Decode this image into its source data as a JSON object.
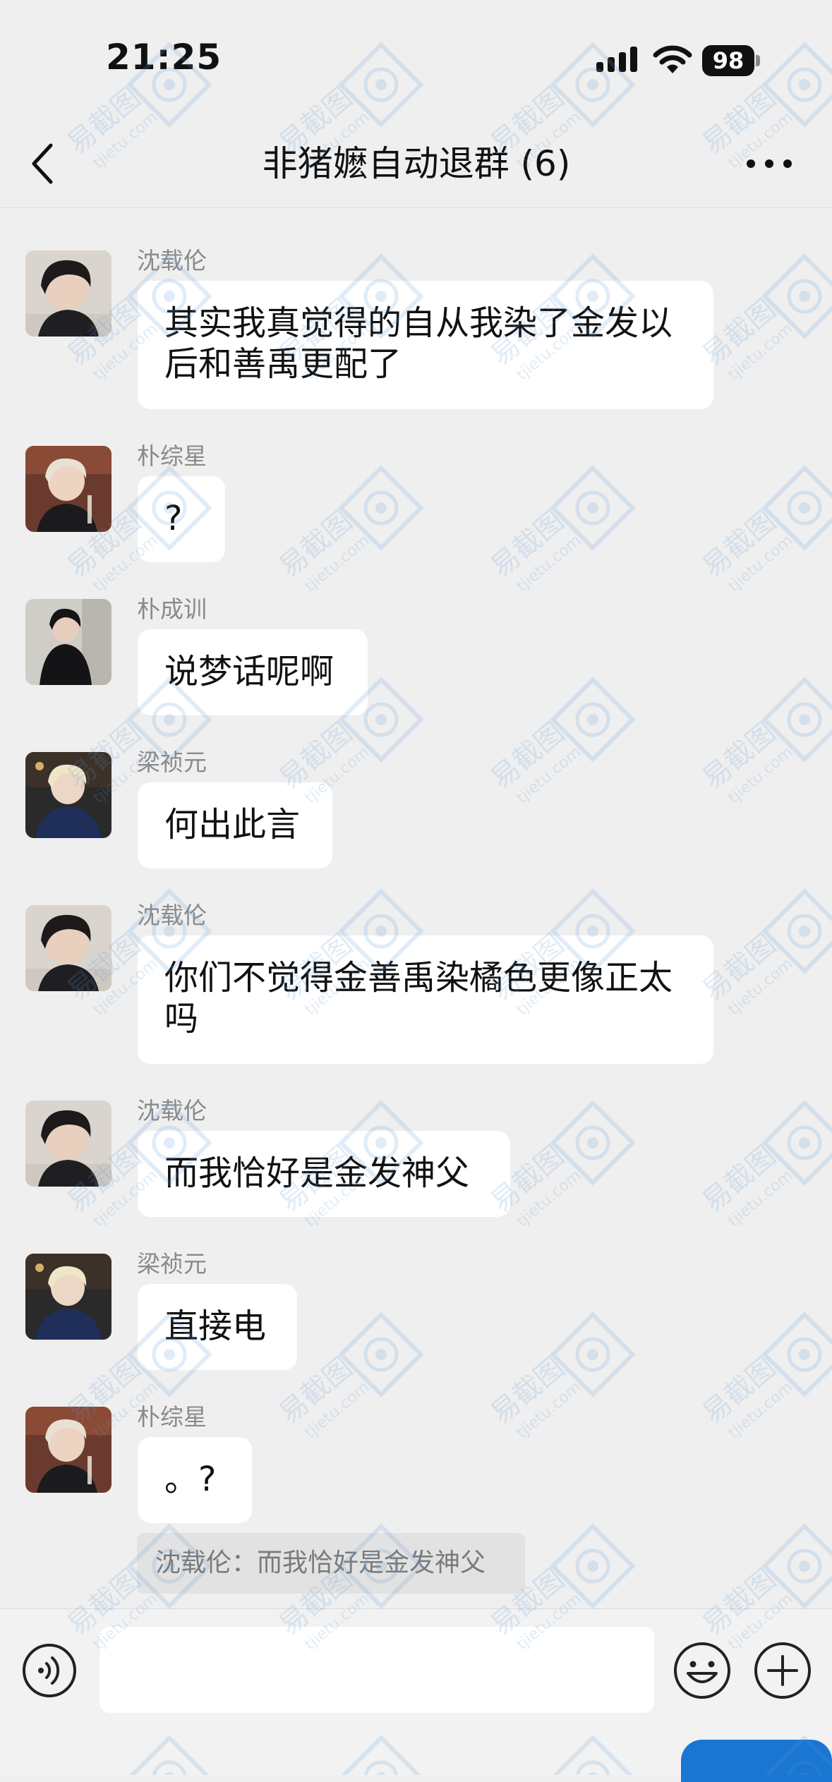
{
  "status": {
    "time": "21:25",
    "battery": "98"
  },
  "header": {
    "title": "非猪嬷自动退群 (6)"
  },
  "messages": [
    {
      "sender": "沈载伦",
      "text": "其实我真觉得的自从我染了金发以\n后和善禹更配了"
    },
    {
      "sender": "朴综星",
      "text": "?"
    },
    {
      "sender": "朴成训",
      "text": "说梦话呢啊"
    },
    {
      "sender": "梁祯元",
      "text": "何出此言"
    },
    {
      "sender": "沈载伦",
      "text": "你们不觉得金善禹染橘色更像正太\n吗"
    },
    {
      "sender": "沈载伦",
      "text": "而我恰好是金发神父"
    },
    {
      "sender": "梁祯元",
      "text": "直接电"
    },
    {
      "sender": "朴综星",
      "text": "。?"
    }
  ],
  "quote": {
    "sender": "沈载伦",
    "separator": "：",
    "text": "而我恰好是金发神父"
  },
  "watermark": {
    "text": "易截图",
    "url": "tjietu.com"
  },
  "colors": {
    "background": "#efefef",
    "bubble": "#ffffff",
    "accent": "#1976d2",
    "watermark": "#5b9bd5"
  },
  "icons": {
    "back": "chevron-left-icon",
    "more": "more-dots-icon",
    "voice": "voice-icon",
    "emoji": "emoji-icon",
    "add": "plus-icon"
  }
}
